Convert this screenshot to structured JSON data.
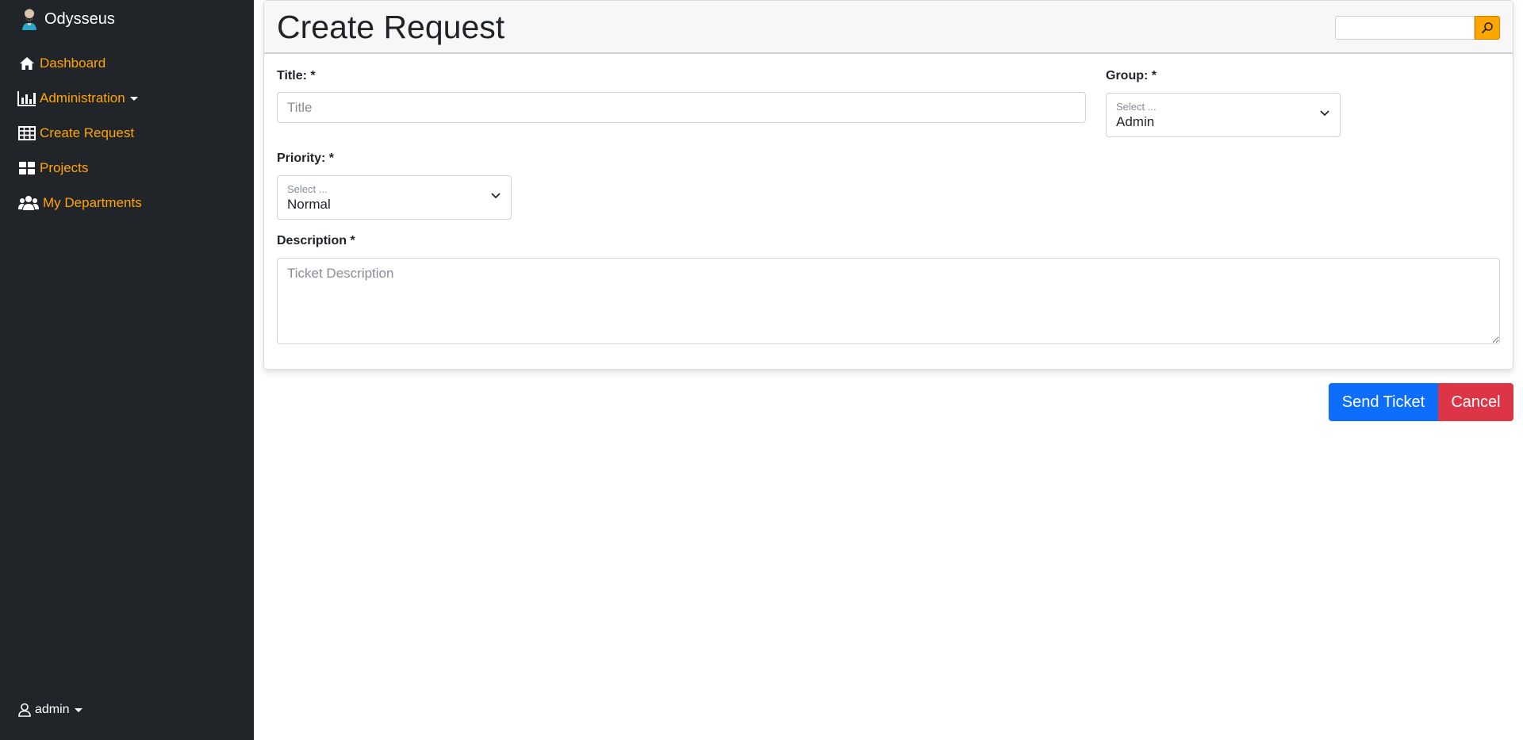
{
  "app": {
    "name": "Odysseus"
  },
  "sidebar": {
    "items": [
      {
        "label": "Dashboard",
        "icon": "home-icon"
      },
      {
        "label": "Administration",
        "icon": "bar-chart-icon",
        "dropdown": true
      },
      {
        "label": "Create Request",
        "icon": "table-icon"
      },
      {
        "label": "Projects",
        "icon": "grid-icon"
      },
      {
        "label": "My Departments",
        "icon": "people-icon"
      }
    ],
    "user": {
      "label": "admin",
      "icon": "person-icon"
    }
  },
  "header": {
    "title": "Create Request",
    "search": {
      "placeholder": "",
      "value": "",
      "icon": "search-icon"
    }
  },
  "form": {
    "title": {
      "label": "Title: *",
      "placeholder": "Title",
      "value": ""
    },
    "group": {
      "label": "Group: *",
      "hint": "Select ...",
      "value": "Admin"
    },
    "priority": {
      "label": "Priority: *",
      "hint": "Select ...",
      "value": "Normal"
    },
    "description": {
      "label": "Description *",
      "placeholder": "Ticket Description",
      "value": ""
    }
  },
  "actions": {
    "send_label": "Send Ticket",
    "cancel_label": "Cancel"
  },
  "colors": {
    "sidebar_bg": "#212529",
    "accent": "#ffa500",
    "primary": "#0d6efd",
    "danger": "#dc3545"
  }
}
